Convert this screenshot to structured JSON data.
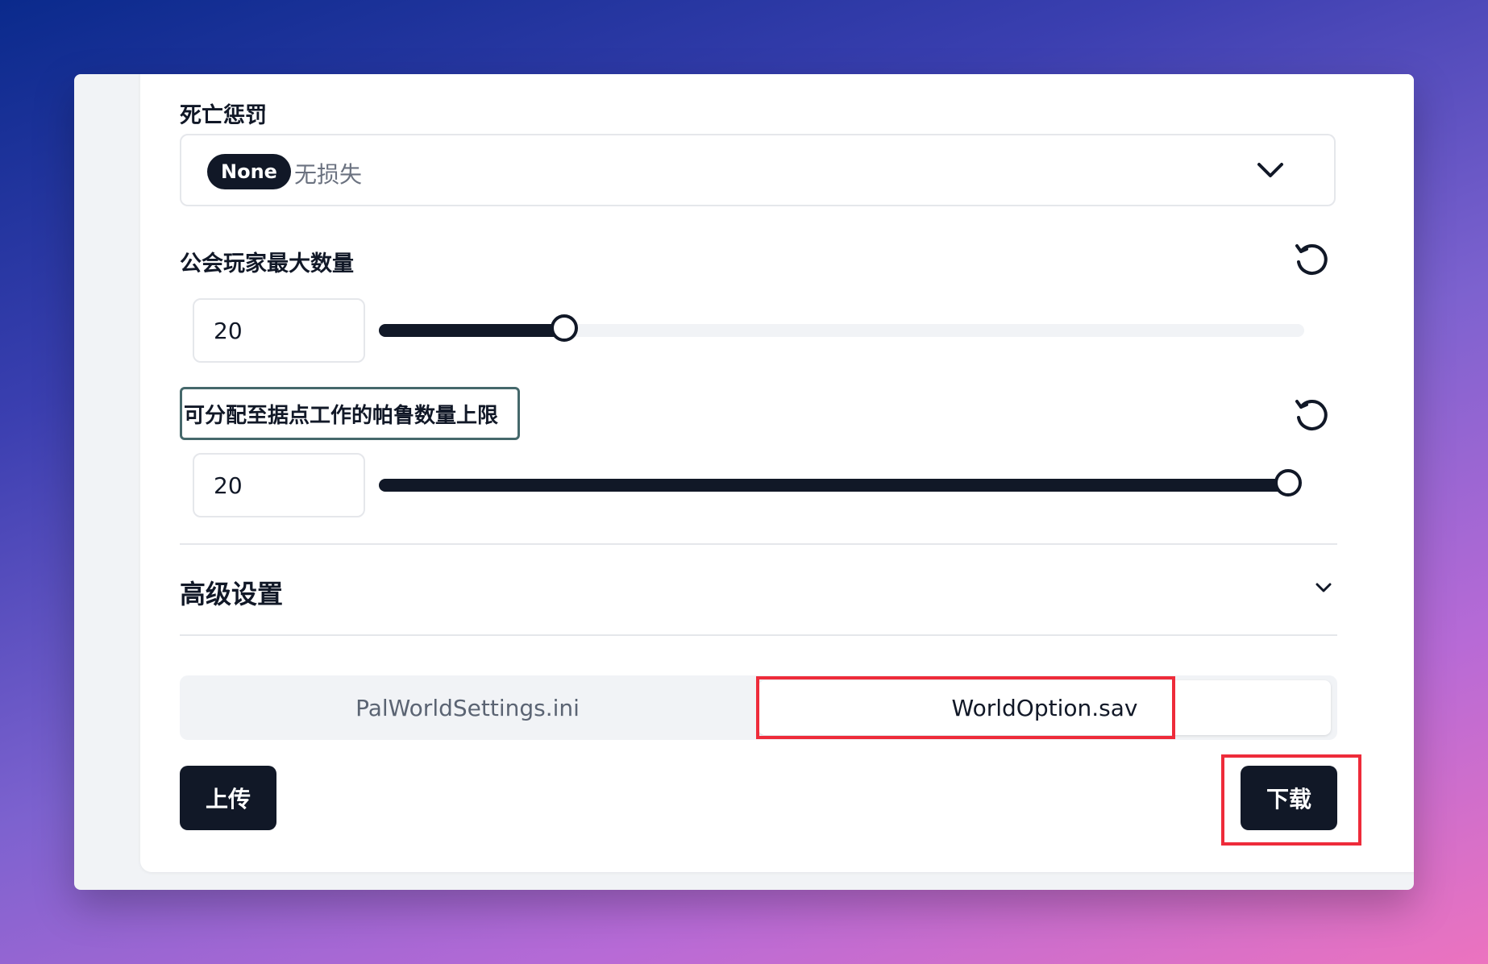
{
  "death_penalty": {
    "label": "死亡惩罚",
    "badge": "None",
    "value": "无损失",
    "icon": "chevron-down-icon"
  },
  "guild_max_players": {
    "label": "公会玩家最大数量",
    "value": "20",
    "slider_fraction": 0.2,
    "reset_icon": "reset-icon"
  },
  "base_camp_workers": {
    "label": "可分配至据点工作的帕鲁数量上限",
    "value": "20",
    "slider_fraction": 1.0,
    "reset_icon": "reset-icon"
  },
  "advanced": {
    "title": "高级设置",
    "icon": "chevron-down-icon"
  },
  "file_tabs": [
    {
      "label": "PalWorldSettings.ini",
      "active": false
    },
    {
      "label": "WorldOption.sav",
      "active": true
    }
  ],
  "actions": {
    "upload_label": "上传",
    "download_label": "下载"
  },
  "colors": {
    "primary": "#111827",
    "highlight": "#ee2b3a",
    "muted_text": "#6b7280"
  }
}
